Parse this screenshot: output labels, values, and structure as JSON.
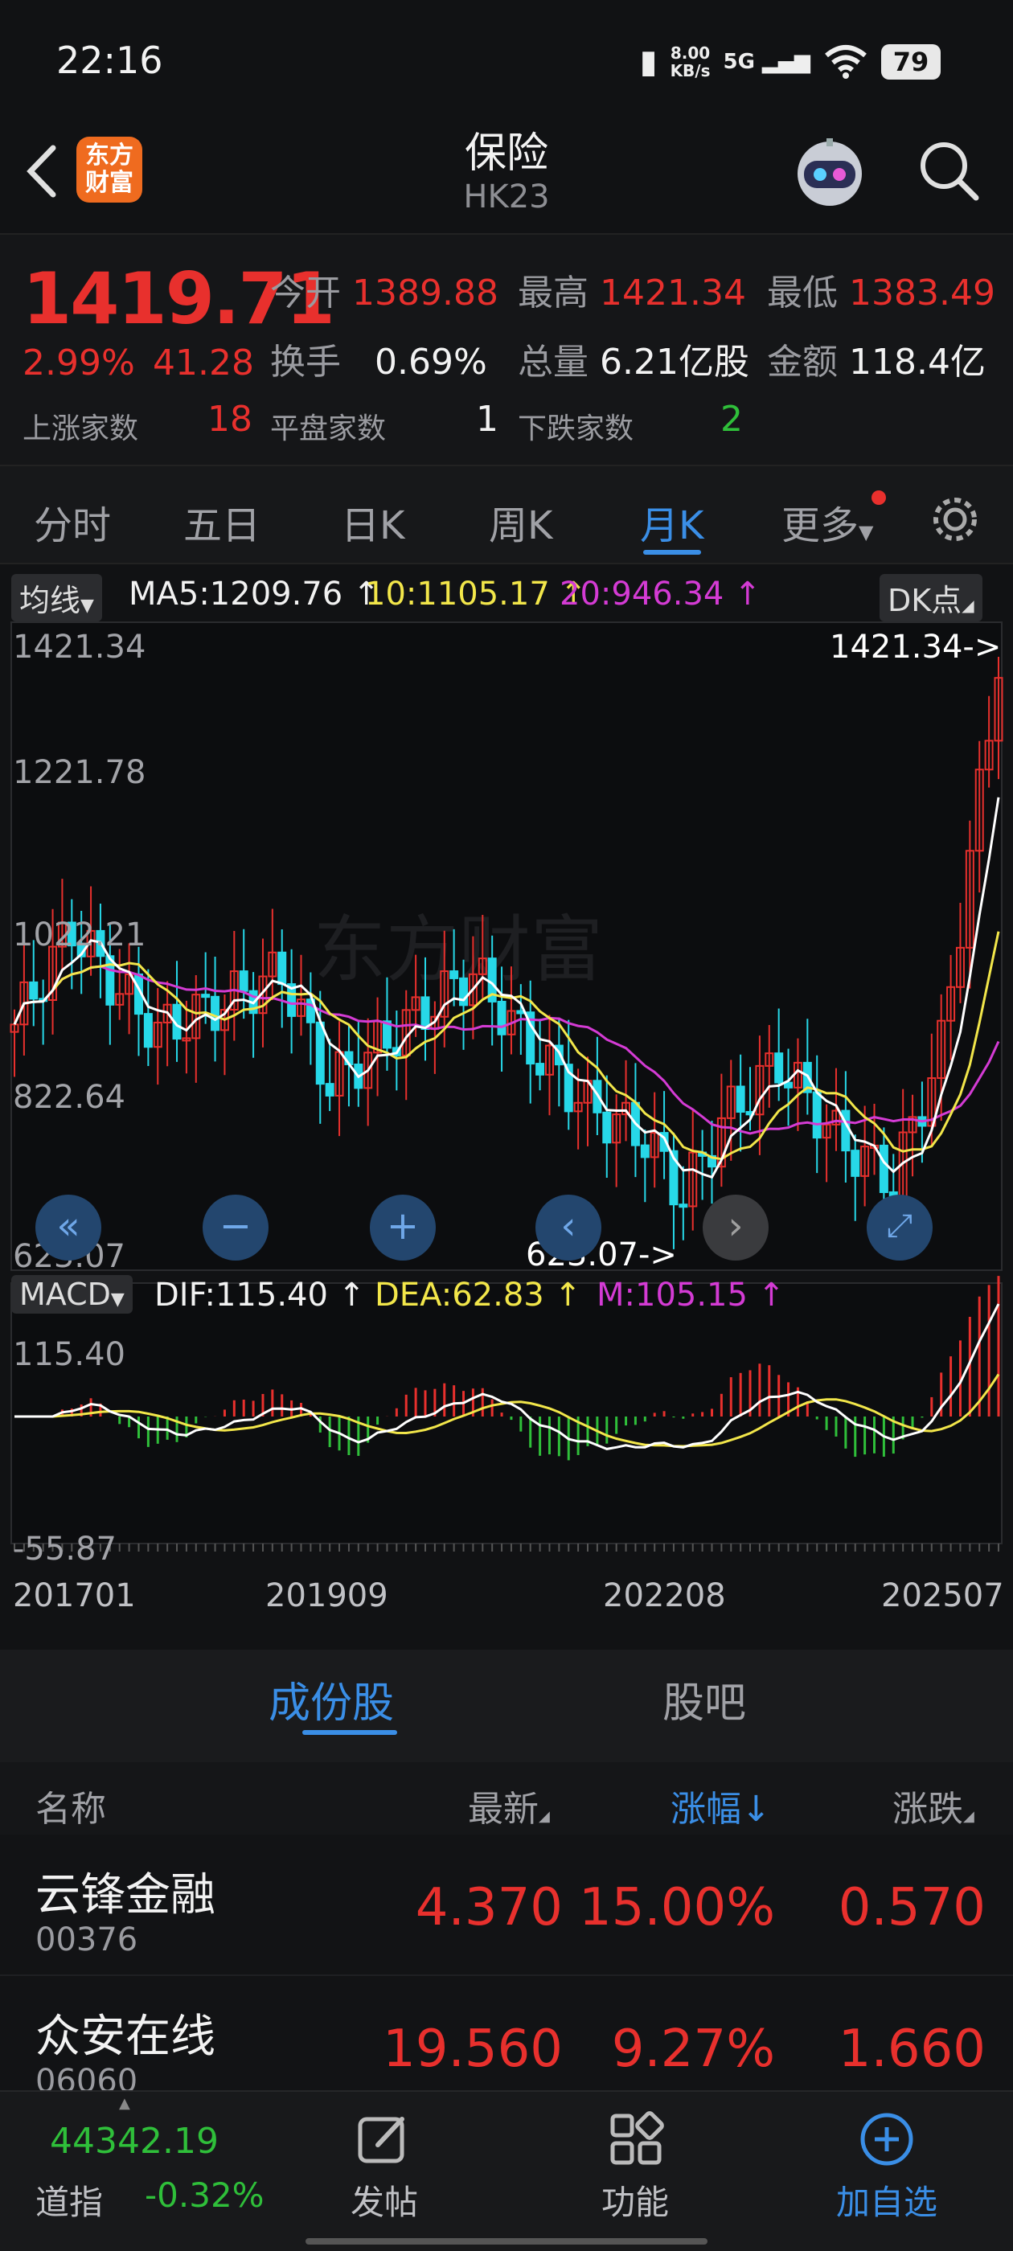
{
  "status": {
    "time": "22:16",
    "speed_value": "8.00",
    "speed_unit": "KB/s",
    "network": "5G",
    "battery": "79"
  },
  "header": {
    "title": "保险",
    "subtitle": "HK23",
    "logo_text": "东方财富",
    "back_icon": "back-icon",
    "search_icon": "search-icon",
    "avatar_icon": "robot-avatar-icon"
  },
  "quote": {
    "price": "1419.71",
    "change_pct": "2.99%",
    "change": "41.28",
    "open_label": "今开",
    "open": "1389.88",
    "high_label": "最高",
    "high": "1421.34",
    "low_label": "最低",
    "low": "1383.49",
    "turnover_label": "换手",
    "turnover": "0.69%",
    "volume_label": "总量",
    "volume": "6.21亿股",
    "amount_label": "金额",
    "amount": "118.4亿",
    "up_label": "上涨家数",
    "up": "18",
    "flat_label": "平盘家数",
    "flat": "1",
    "down_label": "下跌家数",
    "down": "2"
  },
  "tabs": [
    "分时",
    "五日",
    "日K",
    "周K",
    "月K",
    "更多"
  ],
  "active_tab": "月K",
  "ma": {
    "selector": "均线",
    "ma5": "MA5:1209.76",
    "ma10": "10:1105.17",
    "ma20": "20:946.34",
    "dk": "DK点",
    "colors": {
      "ma5": "#ffffff",
      "ma10": "#f2e64a",
      "ma20": "#d43bd4"
    }
  },
  "kline": {
    "yticks": [
      "1421.34",
      "1221.78",
      "1022.21",
      "822.64",
      "623.07"
    ],
    "high_marker": "1421.34->",
    "low_marker": "623.07->",
    "watermark": "东方财富"
  },
  "macd": {
    "selector": "MACD",
    "dif": "DIF:115.40",
    "dea": "DEA:62.83",
    "m": "M:105.15",
    "ytop": "115.40",
    "ybottom": "-55.87"
  },
  "xaxis": [
    "201701",
    "201909",
    "202208",
    "202507"
  ],
  "bottom_tabs": [
    "成份股",
    "股吧"
  ],
  "active_bottom_tab": "成份股",
  "columns": {
    "name": "名称",
    "latest": "最新",
    "pct": "涨幅",
    "chg": "涨跌"
  },
  "stocks": [
    {
      "name": "云锋金融",
      "code": "00376",
      "latest": "4.370",
      "pct": "15.00%",
      "chg": "0.570"
    },
    {
      "name": "众安在线",
      "code": "06060",
      "latest": "19.560",
      "pct": "9.27%",
      "chg": "1.660"
    }
  ],
  "footer": {
    "index_value": "44342.19",
    "index_label": "道指",
    "index_change": "-0.32%",
    "post": "发帖",
    "func": "功能",
    "add": "加自选"
  },
  "colors": {
    "up": "#e8302d",
    "down": "#2fbf3a",
    "accent": "#3a8ee6",
    "candle_up": "#e8302d",
    "candle_down": "#27d8e8"
  }
}
